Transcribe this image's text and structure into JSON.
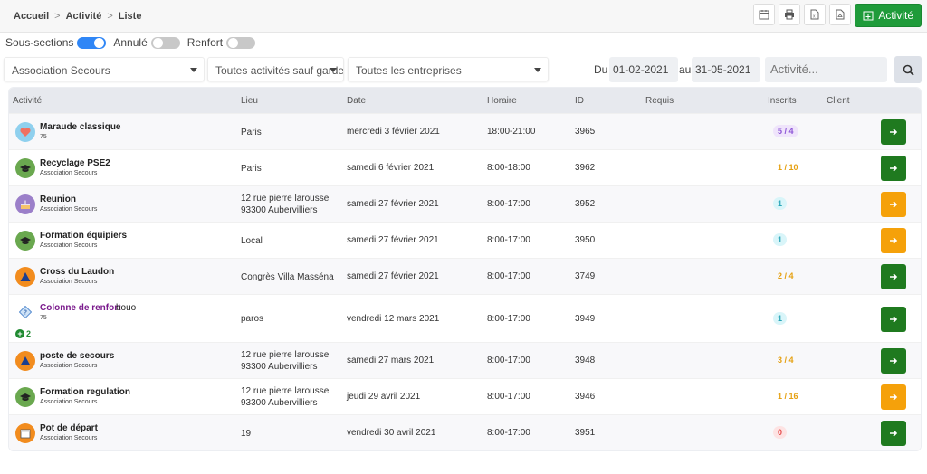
{
  "breadcrumb": [
    "Accueil",
    "Activité",
    "Liste"
  ],
  "toolbar": {
    "add_label": "Activité",
    "buttons": [
      "calendar-icon",
      "print-icon",
      "excel-icon",
      "pdf-icon"
    ]
  },
  "toggles": [
    {
      "label": "Sous-sections",
      "on": true
    },
    {
      "label": "Annulé",
      "on": false
    },
    {
      "label": "Renfort",
      "on": false
    }
  ],
  "filters": {
    "section": "Association Secours",
    "activity_type": "Toutes activités sauf garde",
    "company": "Toutes les entreprises",
    "du_label": "Du",
    "date_from": "01-02-2021",
    "au_label": "au",
    "date_to": "31-05-2021",
    "search_placeholder": "Activité..."
  },
  "columns": [
    "Activité",
    "Lieu",
    "Date",
    "Horaire",
    "ID",
    "Requis",
    "Inscrits",
    "Client"
  ],
  "colors": {
    "green": "#1f7a1f",
    "orange": "#f5a10a",
    "add_green": "#1f9b3a",
    "toggle_on": "#2f86f6"
  },
  "rows": [
    {
      "name": "Maraude classique",
      "sub": "75",
      "icon": "heart-icon",
      "lieu": [
        "Paris"
      ],
      "date": "mercredi 3 février 2021",
      "horaire": "18:00-21:00",
      "id": "3965",
      "inscrits": "5 / 4",
      "badge": "purple",
      "button": "green"
    },
    {
      "name": "Recyclage PSE2",
      "sub": "Association Secours",
      "icon": "graduation-cap-icon",
      "lieu": [
        "Paris"
      ],
      "date": "samedi 6 février 2021",
      "horaire": "8:00-18:00",
      "id": "3962",
      "inscrits": "1 / 10",
      "badge": "orange",
      "button": "green"
    },
    {
      "name": "Reunion",
      "sub": "Association Secours",
      "icon": "cake-icon",
      "lieu": [
        "12 rue pierre larousse",
        "93300 Aubervilliers"
      ],
      "date": "samedi 27 février 2021",
      "horaire": "8:00-17:00",
      "id": "3952",
      "inscrits": "1",
      "badge": "cyan",
      "button": "orange"
    },
    {
      "name": "Formation équipiers",
      "sub": "Association Secours",
      "icon": "graduation-cap-icon",
      "lieu": [
        "Local"
      ],
      "date": "samedi 27 février 2021",
      "horaire": "8:00-17:00",
      "id": "3950",
      "inscrits": "1",
      "badge": "cyan",
      "button": "orange"
    },
    {
      "name": "Cross du Laudon",
      "sub": "Association Secours",
      "icon": "triangle-icon",
      "lieu": [
        "Congrès Villa Masséna"
      ],
      "date": "samedi 27 février 2021",
      "horaire": "8:00-17:00",
      "id": "3749",
      "inscrits": "2 / 4",
      "badge": "orange",
      "button": "green"
    },
    {
      "name": "Colonne de renfort",
      "name_extra": "bouo",
      "sub": "75",
      "icon": "question-diamond-icon",
      "extra": "2",
      "lieu": [
        "paros"
      ],
      "date": "vendredi 12 mars 2021",
      "horaire": "8:00-17:00",
      "id": "3949",
      "inscrits": "1",
      "badge": "cyan",
      "button": "green"
    },
    {
      "name": "poste de secours",
      "sub": "Association Secours",
      "icon": "triangle-icon",
      "lieu": [
        "12 rue pierre larousse",
        "93300 Aubervilliers"
      ],
      "date": "samedi 27 mars 2021",
      "horaire": "8:00-17:00",
      "id": "3948",
      "inscrits": "3 / 4",
      "badge": "orange",
      "button": "green"
    },
    {
      "name": "Formation regulation",
      "sub": "Association Secours",
      "icon": "graduation-cap-icon",
      "lieu": [
        "12 rue pierre larousse",
        "93300 Aubervilliers"
      ],
      "date": "jeudi 29 avril 2021",
      "horaire": "8:00-17:00",
      "id": "3946",
      "inscrits": "1 / 16",
      "badge": "orange",
      "button": "orange"
    },
    {
      "name": "Pot de départ",
      "sub": "Association Secours",
      "icon": "calendar-event-icon",
      "lieu": [
        "19"
      ],
      "date": "vendredi 30 avril 2021",
      "horaire": "8:00-17:00",
      "id": "3951",
      "inscrits": "0",
      "badge": "red",
      "button": "green"
    }
  ]
}
